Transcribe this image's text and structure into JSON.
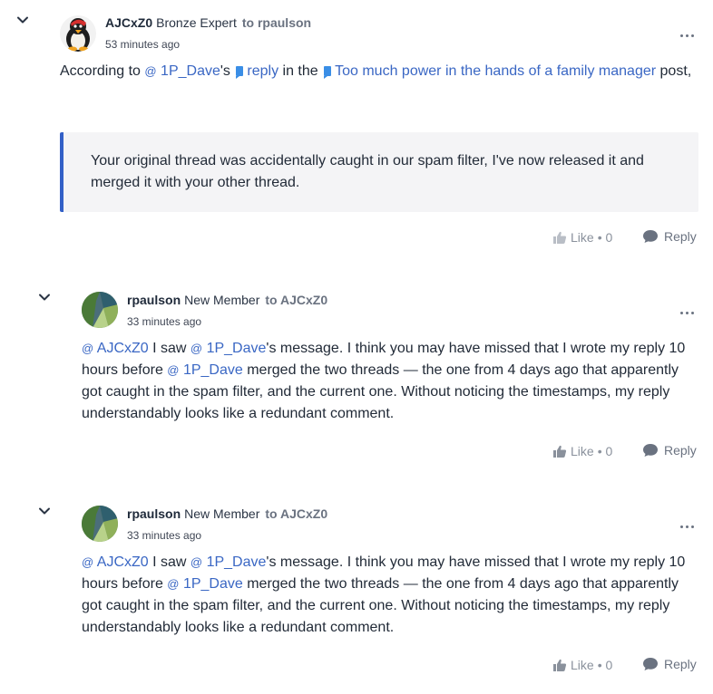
{
  "comments": [
    {
      "author": "AJCxZ0",
      "rank": "Bronze Expert",
      "to_prefix": "to",
      "recipient": "rpaulson",
      "time": "53 minutes ago",
      "body": {
        "p1": "According to ",
        "mention1": "1P_Dave",
        "p2": "'s",
        "reply_link": "reply",
        "p3": " in the ",
        "thread_link": "Too much power in the hands of a family manager",
        "p4": " post,"
      },
      "quote": "Your original thread was accidentally caught in our spam filter, I've now released it and merged it with your other thread.",
      "like_label": "Like",
      "like_count": "• 0",
      "reply_label": "Reply"
    },
    {
      "author": "rpaulson",
      "rank": "New Member",
      "to_prefix": "to",
      "recipient": "AJCxZ0",
      "time": "33 minutes ago",
      "body": {
        "mention1": "AJCxZ0",
        "p1": " I saw ",
        "mention2": "1P_Dave",
        "p2": "'s message. I think you may have missed that I wrote my reply 10 hours before ",
        "mention3": "1P_Dave",
        "p3": " merged the two threads — the one from 4 days ago that apparently got caught in the spam filter, and the current one. Without noticing the timestamps, my reply understandably looks like a redundant comment."
      },
      "like_label": "Like",
      "like_count": "• 0",
      "reply_label": "Reply"
    },
    {
      "author": "rpaulson",
      "rank": "New Member",
      "to_prefix": "to",
      "recipient": "AJCxZ0",
      "time": "33 minutes ago",
      "body": {
        "mention1": "AJCxZ0",
        "p1": " I saw ",
        "mention2": "1P_Dave",
        "p2": "'s message. I think you may have missed that I wrote my reply 10 hours before ",
        "mention3": "1P_Dave",
        "p3": " merged the two threads — the one from 4 days ago that apparently got caught in the spam filter, and the current one. Without noticing the timestamps, my reply understandably looks like a redundant comment."
      },
      "like_label": "Like",
      "like_count": "• 0",
      "reply_label": "Reply"
    }
  ],
  "icons": {
    "collapse": "chevron-down-icon",
    "more": "more-options-icon",
    "like": "thumbs-up-icon",
    "reply": "speech-bubble-icon",
    "mention": "at-sign-icon",
    "link": "post-flag-icon"
  },
  "colors": {
    "link": "#3a67c4",
    "quote_border": "#3360c7",
    "quote_bg": "#f4f4f6",
    "muted": "#8a919c"
  }
}
